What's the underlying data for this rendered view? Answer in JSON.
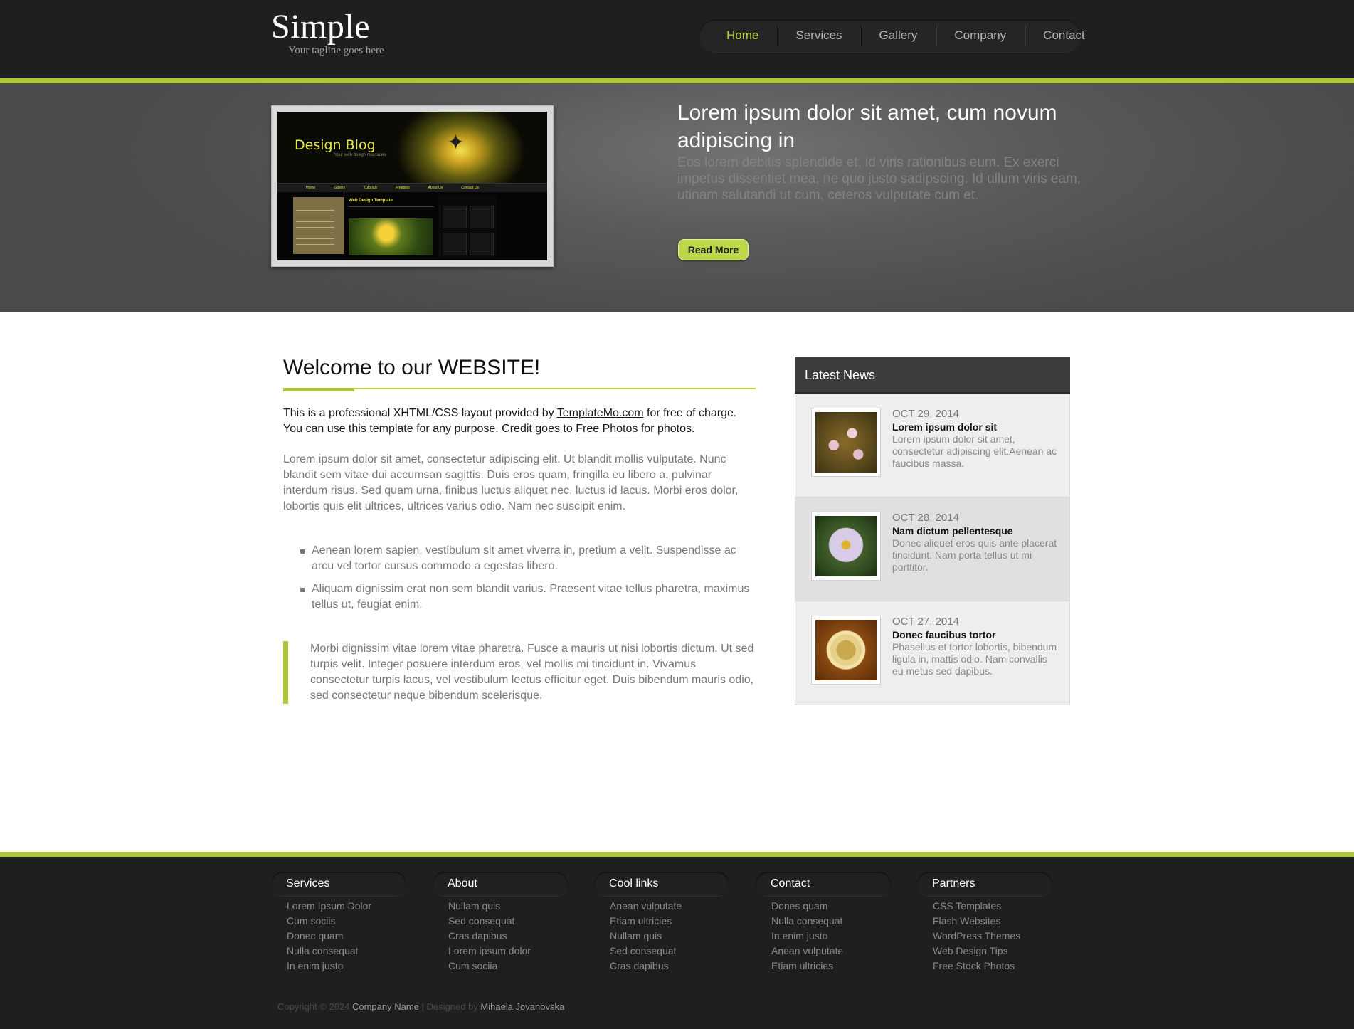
{
  "header": {
    "logo": "Simple",
    "tagline": "Your tagline goes here",
    "nav": [
      {
        "label": "Home",
        "active": true
      },
      {
        "label": "Services",
        "active": false
      },
      {
        "label": "Gallery",
        "active": false
      },
      {
        "label": "Company",
        "active": false
      },
      {
        "label": "Contact",
        "active": false
      }
    ]
  },
  "hero": {
    "screenshot": {
      "title": "Design Blog",
      "subtitle": "Your web design resources",
      "nav": [
        "Home",
        "Gallery",
        "Tutorials",
        "Freebies",
        "About Us",
        "Contact Us"
      ],
      "post_title": "Web Design Template"
    },
    "title": "Lorem ipsum dolor sit amet, cum novum adipiscing in",
    "text": "Eos lorem debitis splendide et, id viris rationibus eum. Ex exerci impetus dissentiet mea, ne quo justo sadipscing. Id ullum viris eam, utinam salutandi ut cum, ceteros vulputate cum et.",
    "button": "Read More"
  },
  "main": {
    "title": "Welcome to our WEBSITE!",
    "intro_1": "This is a professional XHTML/CSS layout provided by ",
    "intro_link_1": "TemplateMo.com",
    "intro_2": " for free of charge. You can use this template for any purpose. Credit goes to ",
    "intro_link_2": "Free Photos",
    "intro_3": " for photos.",
    "paragraph": "Lorem ipsum dolor sit amet, consectetur adipiscing elit. Ut blandit mollis vulputate. Nunc blandit sem vitae dui accumsan sagittis. Duis eros quam, fringilla eu libero a, pulvinar interdum risus. Sed quam urna, finibus luctus aliquet nec, luctus id lacus. Morbi eros dolor, lobortis quis elit ultrices, ultrices varius odio. Nam nec suscipit enim.",
    "bullets": [
      "Aenean lorem sapien, vestibulum sit amet viverra in, pretium a velit. Suspendisse ac arcu vel tortor cursus commodo a egestas libero.",
      "Aliquam dignissim erat non sem blandit varius. Praesent vitae tellus pharetra, maximus tellus ut, feugiat enim."
    ],
    "quote": "Morbi dignissim vitae lorem vitae pharetra. Fusce a mauris ut nisi lobortis dictum. Ut sed turpis velit. Integer posuere interdum eros, vel mollis mi tincidunt in. Vivamus consectetur turpis lacus, vel vestibulum lectus efficitur eget. Duis bibendum mauris odio, sed consectetur neque bibendum scelerisque."
  },
  "news": {
    "heading": "Latest News",
    "items": [
      {
        "date": "OCT 29, 2014",
        "title": "Lorem ipsum dolor sit",
        "text": "Lorem ipsum dolor sit amet, consectetur adipiscing elit.Aenean ac faucibus massa."
      },
      {
        "date": "OCT 28, 2014",
        "title": "Nam dictum pellentesque",
        "text": "Donec aliquet eros quis ante placerat tincidunt. Nam porta tellus ut mi porttitor."
      },
      {
        "date": "OCT 27, 2014",
        "title": "Donec faucibus tortor",
        "text": "Phasellus et tortor lobortis, bibendum ligula in, mattis odio. Nam convallis eu metus sed dapibus."
      }
    ]
  },
  "footer": {
    "columns": [
      {
        "heading": "Services",
        "links": [
          "Lorem Ipsum Dolor",
          "Cum sociis",
          "Donec quam",
          "Nulla consequat",
          "In enim justo"
        ]
      },
      {
        "heading": "About",
        "links": [
          "Nullam quis",
          "Sed consequat",
          "Cras dapibus",
          "Lorem ipsum dolor",
          "Cum sociia"
        ]
      },
      {
        "heading": "Cool links",
        "links": [
          "Anean vulputate",
          "Etiam ultricies",
          "Nullam quis",
          "Sed consequat",
          "Cras dapibus"
        ]
      },
      {
        "heading": "Contact",
        "links": [
          "Dones quam",
          "Nulla consequat",
          "In enim justo",
          "Anean vulputate",
          "Etiam ultricies"
        ]
      },
      {
        "heading": "Partners",
        "links": [
          "CSS Templates",
          "Flash Websites",
          "WordPress Themes",
          "Web Design Tips",
          "Free Stock Photos"
        ]
      }
    ],
    "copyright_prefix": "Copyright © 2024 ",
    "company": "Company Name",
    "designed_by": " | Designed by ",
    "designer": "Mihaela Jovanovska"
  },
  "colors": {
    "accent": "#adc93a",
    "header_bg": "#1d201f",
    "hero_bg": "#5a5a5a",
    "news_head": "#3c3c3c"
  }
}
